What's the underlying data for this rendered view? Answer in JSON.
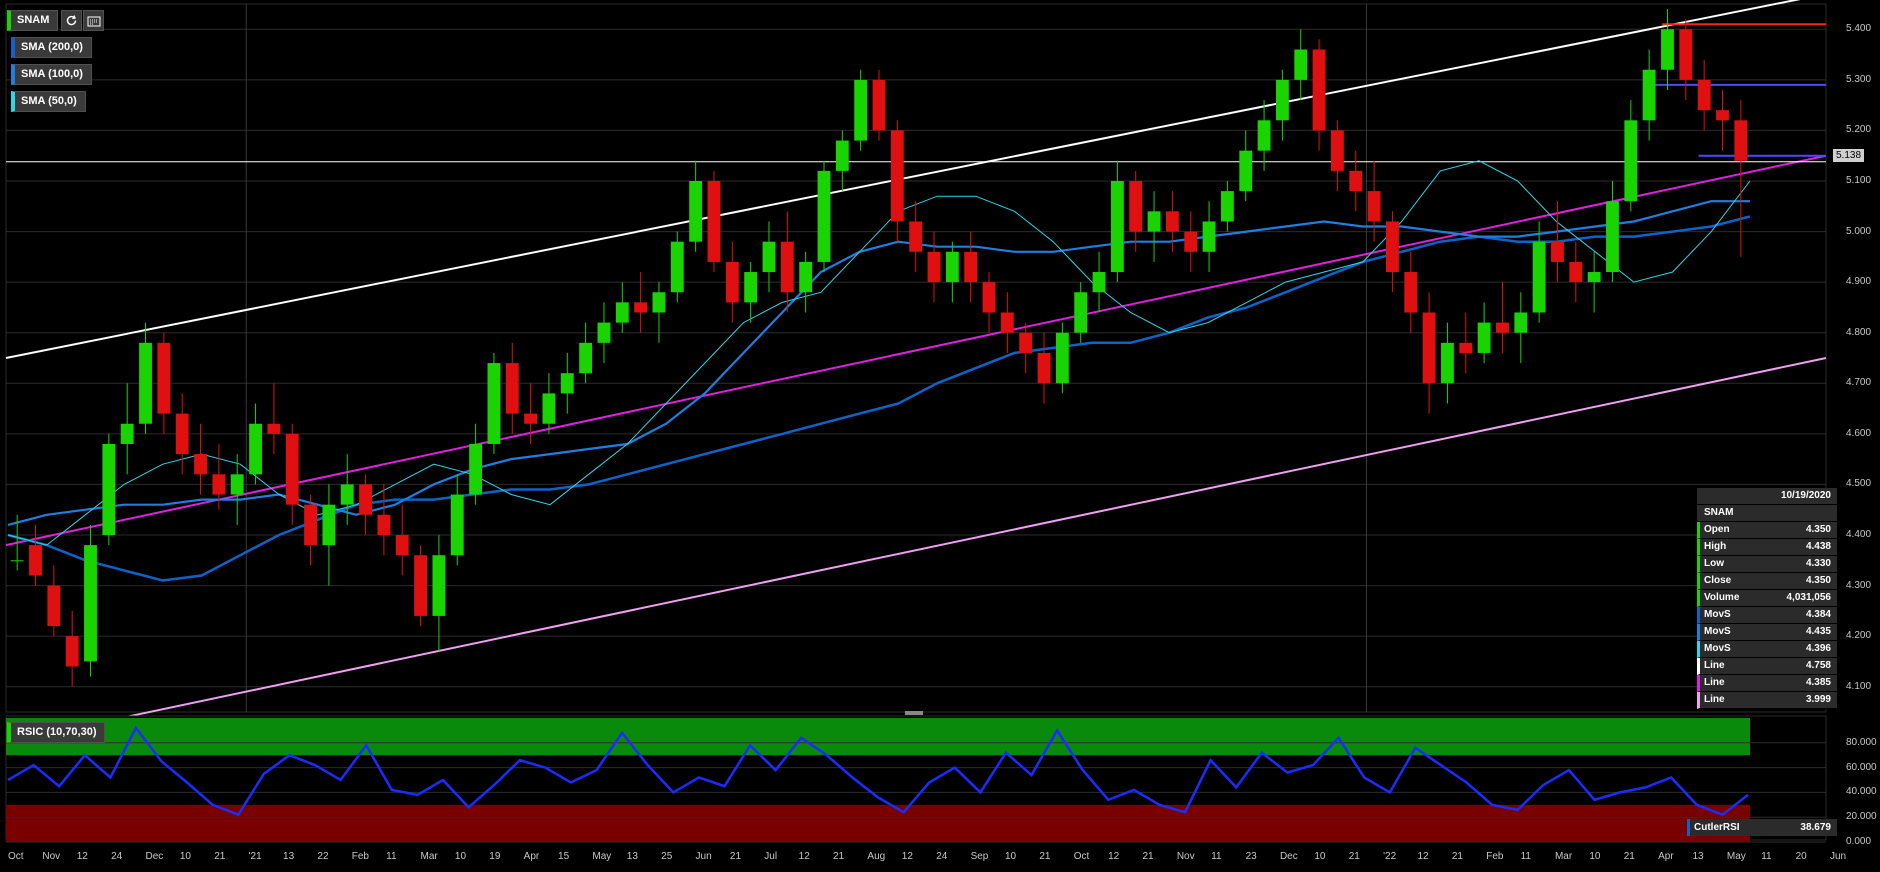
{
  "toolbar": {
    "symbol": "SNAM",
    "indicators": [
      "SMA (200,0)",
      "SMA (100,0)",
      "SMA (50,0)"
    ],
    "indicator_colors": [
      "#0e63c9",
      "#1e7fe0",
      "#2bd7e8"
    ],
    "refresh_icon": "refresh-icon",
    "calendar_icon": "calendar-icon"
  },
  "price_tag": "5.138",
  "info_panel": {
    "date": "10/19/2020",
    "symbol": "SNAM",
    "rows": [
      {
        "label": "Open",
        "value": "4.350",
        "color": "#19d400"
      },
      {
        "label": "High",
        "value": "4.438",
        "color": "#19d400"
      },
      {
        "label": "Low",
        "value": "4.330",
        "color": "#19d400"
      },
      {
        "label": "Close",
        "value": "4.350",
        "color": "#19d400"
      },
      {
        "label": "Volume",
        "value": "4,031,056",
        "color": "#19d400"
      },
      {
        "label": "MovS",
        "value": "4.384",
        "color": "#0e63c9"
      },
      {
        "label": "MovS",
        "value": "4.435",
        "color": "#1e7fe0"
      },
      {
        "label": "MovS",
        "value": "4.396",
        "color": "#2bd7e8"
      },
      {
        "label": "Line",
        "value": "4.758",
        "color": "#ffffff"
      },
      {
        "label": "Line",
        "value": "4.385",
        "color": "#e020e0"
      },
      {
        "label": "Line",
        "value": "3.999",
        "color": "#f0a0f0"
      }
    ]
  },
  "rsi_panel": {
    "title": "RSIC (10,70,30)",
    "readout_label": "CutlerRSI",
    "readout_value": "38.679"
  },
  "chart_data": {
    "type": "candlestick",
    "symbol": "SNAM",
    "x_tick_labels": [
      "Oct",
      "Nov",
      "12",
      "24",
      "Dec",
      "10",
      "21",
      "'21",
      "13",
      "22",
      "Feb",
      "11",
      "Mar",
      "10",
      "19",
      "Apr",
      "15",
      "May",
      "13",
      "25",
      "Jun",
      "21",
      "Jul",
      "12",
      "21",
      "Aug",
      "12",
      "24",
      "Sep",
      "10",
      "21",
      "Oct",
      "12",
      "21",
      "Nov",
      "11",
      "23",
      "Dec",
      "10",
      "21",
      "'22",
      "12",
      "21",
      "Feb",
      "11",
      "Mar",
      "10",
      "21",
      "Apr",
      "13",
      "May",
      "11",
      "20",
      "Jun"
    ],
    "y_tick_labels": [
      "5.400",
      "5.300",
      "5.200",
      "5.100",
      "5.000",
      "4.900",
      "4.800",
      "4.700",
      "4.600",
      "4.500",
      "4.400",
      "4.300",
      "4.200",
      "4.100"
    ],
    "ylim": [
      4.05,
      5.45
    ],
    "last_price": 5.138,
    "candles": [
      [
        4.35,
        4.44,
        4.33,
        4.35
      ],
      [
        4.38,
        4.42,
        4.3,
        4.32
      ],
      [
        4.3,
        4.34,
        4.2,
        4.22
      ],
      [
        4.2,
        4.25,
        4.1,
        4.14
      ],
      [
        4.15,
        4.42,
        4.12,
        4.38
      ],
      [
        4.4,
        4.6,
        4.38,
        4.58
      ],
      [
        4.58,
        4.7,
        4.52,
        4.62
      ],
      [
        4.62,
        4.82,
        4.6,
        4.78
      ],
      [
        4.78,
        4.8,
        4.6,
        4.64
      ],
      [
        4.64,
        4.68,
        4.52,
        4.56
      ],
      [
        4.56,
        4.62,
        4.48,
        4.52
      ],
      [
        4.52,
        4.58,
        4.45,
        4.48
      ],
      [
        4.48,
        4.56,
        4.42,
        4.52
      ],
      [
        4.52,
        4.66,
        4.5,
        4.62
      ],
      [
        4.62,
        4.7,
        4.56,
        4.6
      ],
      [
        4.6,
        4.62,
        4.42,
        4.46
      ],
      [
        4.46,
        4.48,
        4.34,
        4.38
      ],
      [
        4.38,
        4.5,
        4.3,
        4.46
      ],
      [
        4.46,
        4.56,
        4.42,
        4.5
      ],
      [
        4.5,
        4.52,
        4.4,
        4.44
      ],
      [
        4.44,
        4.5,
        4.36,
        4.4
      ],
      [
        4.4,
        4.46,
        4.32,
        4.36
      ],
      [
        4.36,
        4.38,
        4.22,
        4.24
      ],
      [
        4.24,
        4.4,
        4.17,
        4.36
      ],
      [
        4.36,
        4.52,
        4.34,
        4.48
      ],
      [
        4.48,
        4.62,
        4.46,
        4.58
      ],
      [
        4.58,
        4.76,
        4.56,
        4.74
      ],
      [
        4.74,
        4.78,
        4.6,
        4.64
      ],
      [
        4.64,
        4.7,
        4.58,
        4.62
      ],
      [
        4.62,
        4.72,
        4.6,
        4.68
      ],
      [
        4.68,
        4.76,
        4.64,
        4.72
      ],
      [
        4.72,
        4.82,
        4.7,
        4.78
      ],
      [
        4.78,
        4.86,
        4.74,
        4.82
      ],
      [
        4.82,
        4.9,
        4.8,
        4.86
      ],
      [
        4.86,
        4.92,
        4.8,
        4.84
      ],
      [
        4.84,
        4.9,
        4.78,
        4.88
      ],
      [
        4.88,
        5.0,
        4.86,
        4.98
      ],
      [
        4.98,
        5.14,
        4.96,
        5.1
      ],
      [
        5.1,
        5.12,
        4.92,
        4.94
      ],
      [
        4.94,
        4.98,
        4.82,
        4.86
      ],
      [
        4.86,
        4.94,
        4.82,
        4.92
      ],
      [
        4.92,
        5.02,
        4.88,
        4.98
      ],
      [
        4.98,
        5.04,
        4.84,
        4.88
      ],
      [
        4.88,
        4.96,
        4.84,
        4.94
      ],
      [
        4.94,
        5.14,
        4.92,
        5.12
      ],
      [
        5.12,
        5.2,
        5.08,
        5.18
      ],
      [
        5.18,
        5.32,
        5.16,
        5.3
      ],
      [
        5.3,
        5.32,
        5.18,
        5.2
      ],
      [
        5.2,
        5.22,
        4.98,
        5.02
      ],
      [
        5.02,
        5.06,
        4.92,
        4.96
      ],
      [
        4.96,
        5.0,
        4.86,
        4.9
      ],
      [
        4.9,
        4.98,
        4.86,
        4.96
      ],
      [
        4.96,
        5.0,
        4.86,
        4.9
      ],
      [
        4.9,
        4.92,
        4.8,
        4.84
      ],
      [
        4.84,
        4.88,
        4.76,
        4.8
      ],
      [
        4.8,
        4.82,
        4.72,
        4.76
      ],
      [
        4.76,
        4.8,
        4.66,
        4.7
      ],
      [
        4.7,
        4.82,
        4.68,
        4.8
      ],
      [
        4.8,
        4.9,
        4.78,
        4.88
      ],
      [
        4.88,
        4.96,
        4.84,
        4.92
      ],
      [
        4.92,
        5.14,
        4.9,
        5.1
      ],
      [
        5.1,
        5.12,
        4.96,
        5.0
      ],
      [
        5.0,
        5.08,
        4.94,
        5.04
      ],
      [
        5.04,
        5.08,
        4.96,
        5.0
      ],
      [
        5.0,
        5.04,
        4.92,
        4.96
      ],
      [
        4.96,
        5.06,
        4.92,
        5.02
      ],
      [
        5.02,
        5.1,
        5.0,
        5.08
      ],
      [
        5.08,
        5.2,
        5.06,
        5.16
      ],
      [
        5.16,
        5.26,
        5.12,
        5.22
      ],
      [
        5.22,
        5.32,
        5.18,
        5.3
      ],
      [
        5.3,
        5.4,
        5.26,
        5.36
      ],
      [
        5.36,
        5.38,
        5.16,
        5.2
      ],
      [
        5.2,
        5.22,
        5.08,
        5.12
      ],
      [
        5.12,
        5.16,
        5.04,
        5.08
      ],
      [
        5.08,
        5.14,
        4.98,
        5.02
      ],
      [
        5.02,
        5.04,
        4.88,
        4.92
      ],
      [
        4.92,
        4.96,
        4.8,
        4.84
      ],
      [
        4.84,
        4.88,
        4.64,
        4.7
      ],
      [
        4.7,
        4.82,
        4.66,
        4.78
      ],
      [
        4.78,
        4.84,
        4.72,
        4.76
      ],
      [
        4.76,
        4.86,
        4.74,
        4.82
      ],
      [
        4.82,
        4.9,
        4.76,
        4.8
      ],
      [
        4.8,
        4.88,
        4.74,
        4.84
      ],
      [
        4.84,
        5.02,
        4.82,
        4.98
      ],
      [
        4.98,
        5.06,
        4.9,
        4.94
      ],
      [
        4.94,
        4.98,
        4.86,
        4.9
      ],
      [
        4.9,
        4.96,
        4.84,
        4.92
      ],
      [
        4.92,
        5.1,
        4.9,
        5.06
      ],
      [
        5.06,
        5.26,
        5.04,
        5.22
      ],
      [
        5.22,
        5.36,
        5.18,
        5.32
      ],
      [
        5.32,
        5.44,
        5.28,
        5.4
      ],
      [
        5.4,
        5.42,
        5.26,
        5.3
      ],
      [
        5.3,
        5.34,
        5.2,
        5.24
      ],
      [
        5.24,
        5.28,
        5.16,
        5.22
      ],
      [
        5.22,
        5.26,
        4.95,
        5.14
      ]
    ],
    "sma_200": [
      4.4,
      4.38,
      4.35,
      4.33,
      4.31,
      4.32,
      4.36,
      4.4,
      4.43,
      4.46,
      4.47,
      4.47,
      4.48,
      4.49,
      4.49,
      4.5,
      4.52,
      4.54,
      4.56,
      4.58,
      4.6,
      4.62,
      4.64,
      4.66,
      4.7,
      4.73,
      4.76,
      4.77,
      4.78,
      4.78,
      4.8,
      4.83,
      4.85,
      4.88,
      4.91,
      4.94,
      4.96,
      4.98,
      4.99,
      4.98,
      4.98,
      4.99,
      4.99,
      5.0,
      5.01,
      5.03
    ],
    "sma_100": [
      4.42,
      4.44,
      4.45,
      4.46,
      4.46,
      4.47,
      4.47,
      4.48,
      4.46,
      4.44,
      4.46,
      4.5,
      4.53,
      4.55,
      4.56,
      4.57,
      4.58,
      4.62,
      4.68,
      4.76,
      4.84,
      4.92,
      4.96,
      4.98,
      4.97,
      4.97,
      4.96,
      4.96,
      4.97,
      4.98,
      4.98,
      4.99,
      5.0,
      5.01,
      5.02,
      5.01,
      5.01,
      5.0,
      4.99,
      4.99,
      5.0,
      5.01,
      5.02,
      5.04,
      5.06,
      5.06
    ],
    "sma_50": [
      4.4,
      4.38,
      4.44,
      4.5,
      4.54,
      4.56,
      4.54,
      4.48,
      4.44,
      4.46,
      4.5,
      4.54,
      4.52,
      4.48,
      4.46,
      4.52,
      4.58,
      4.66,
      4.74,
      4.82,
      4.86,
      4.88,
      4.96,
      5.04,
      5.07,
      5.07,
      5.04,
      4.98,
      4.9,
      4.84,
      4.8,
      4.82,
      4.86,
      4.9,
      4.92,
      4.94,
      5.02,
      5.12,
      5.14,
      5.1,
      5.02,
      4.96,
      4.9,
      4.92,
      5.0,
      5.1
    ],
    "trend_lines": [
      {
        "name": "upper",
        "color": "#ffffff",
        "from": [
          0,
          4.75
        ],
        "to": [
          1,
          5.47
        ]
      },
      {
        "name": "middle",
        "color": "#e020e0",
        "from": [
          0,
          4.38
        ],
        "to": [
          1,
          5.15
        ]
      },
      {
        "name": "lower",
        "color": "#f0a0f0",
        "from": [
          0,
          3.99
        ],
        "to": [
          1,
          4.75
        ]
      }
    ],
    "horizontal_lines": [
      {
        "value": 5.138,
        "color": "#ffffff"
      },
      {
        "value": 5.41,
        "color": "#ff2020",
        "x_start": 0.91
      },
      {
        "value": 5.29,
        "color": "#4a4aff",
        "x_start": 0.9
      },
      {
        "value": 5.15,
        "color": "#4a4aff",
        "x_start": 0.93
      }
    ],
    "rsi": {
      "name": "CutlerRSI",
      "overbought": 70,
      "oversold": 30,
      "y_tick_labels": [
        "80.000",
        "60.000",
        "40.000",
        "20.000",
        "0.000"
      ],
      "values": [
        50,
        62,
        45,
        70,
        52,
        92,
        65,
        48,
        30,
        22,
        55,
        70,
        62,
        50,
        78,
        42,
        38,
        50,
        28,
        46,
        66,
        60,
        48,
        58,
        88,
        62,
        40,
        52,
        45,
        78,
        58,
        84,
        70,
        52,
        36,
        24,
        48,
        60,
        40,
        72,
        54,
        90,
        58,
        34,
        42,
        30,
        24,
        66,
        44,
        72,
        56,
        62,
        84,
        52,
        40,
        76,
        62,
        48,
        30,
        26,
        46,
        58,
        34,
        40,
        44,
        52,
        30,
        22,
        38
      ]
    }
  }
}
